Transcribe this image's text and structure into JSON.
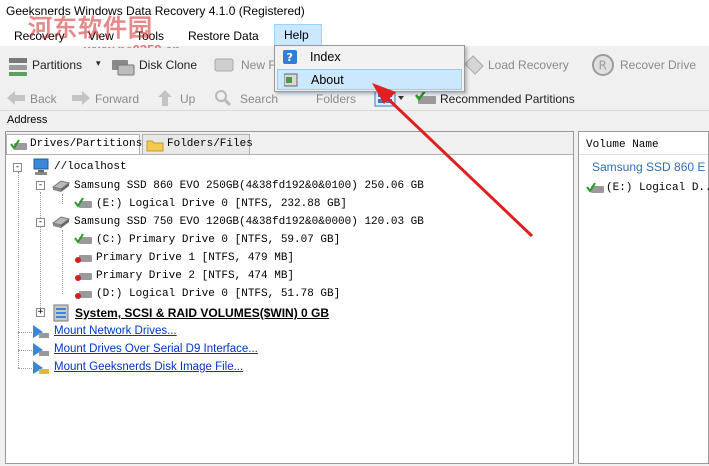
{
  "window": {
    "title": "Geeksnerds Windows Data Recovery 4.1.0 (Registered)"
  },
  "watermark": {
    "cn": "河东软件园",
    "url": "www.pc0359.cn"
  },
  "menubar": {
    "items": [
      "Recovery",
      "View",
      "Tools",
      "Restore Data",
      "Help"
    ]
  },
  "help_menu": {
    "items": [
      {
        "label": "Index",
        "icon": "help-question-icon"
      },
      {
        "label": "About",
        "icon": "about-info-icon"
      }
    ]
  },
  "toolbar1": {
    "partitions": "Partitions",
    "disk_clone": "Disk Clone",
    "new": "New F",
    "load_recovery": "Load Recovery",
    "recover_drive": "Recover Drive"
  },
  "toolbar2": {
    "back": "Back",
    "forward": "Forward",
    "up": "Up",
    "search": "Search",
    "folders": "Folders",
    "recommended": "Recommended Partitions"
  },
  "address": {
    "label": "Address",
    "value": ""
  },
  "tabs": {
    "drives": "Drives/Partitions",
    "folders": "Folders/Files"
  },
  "tree": {
    "root": "//localhost",
    "disk1": "Samsung SSD 860 EVO 250GB(4&38fd192&0&0100) 250.06 GB",
    "disk1_parts": [
      "(E:) Logical Drive 0 [NTFS, 232.88 GB]"
    ],
    "disk2": "Samsung SSD 750 EVO 120GB(4&38fd192&0&0000) 120.03 GB",
    "disk2_parts": [
      "(C:) Primary Drive 0 [NTFS, 59.07 GB]",
      "Primary Drive 1 [NTFS, 479 MB]",
      "Primary Drive 2 [NTFS, 474 MB]",
      "(D:) Logical Drive 0 [NTFS, 51.78 GB]"
    ],
    "raid": "System, SCSI & RAID VOLUMES($WIN) 0 GB",
    "links": [
      "Mount Network Drives...",
      "Mount Drives Over Serial D9 Interface...",
      "Mount Geeksnerds Disk Image File..."
    ]
  },
  "right": {
    "header": "Volume Name",
    "disk": "Samsung SSD 860 E",
    "part": "(E:) Logical D..."
  },
  "colors": {
    "accent": "#cce8ff",
    "link": "#0033cc",
    "arrow": "#e02020",
    "highlight": "#99d1ff"
  }
}
